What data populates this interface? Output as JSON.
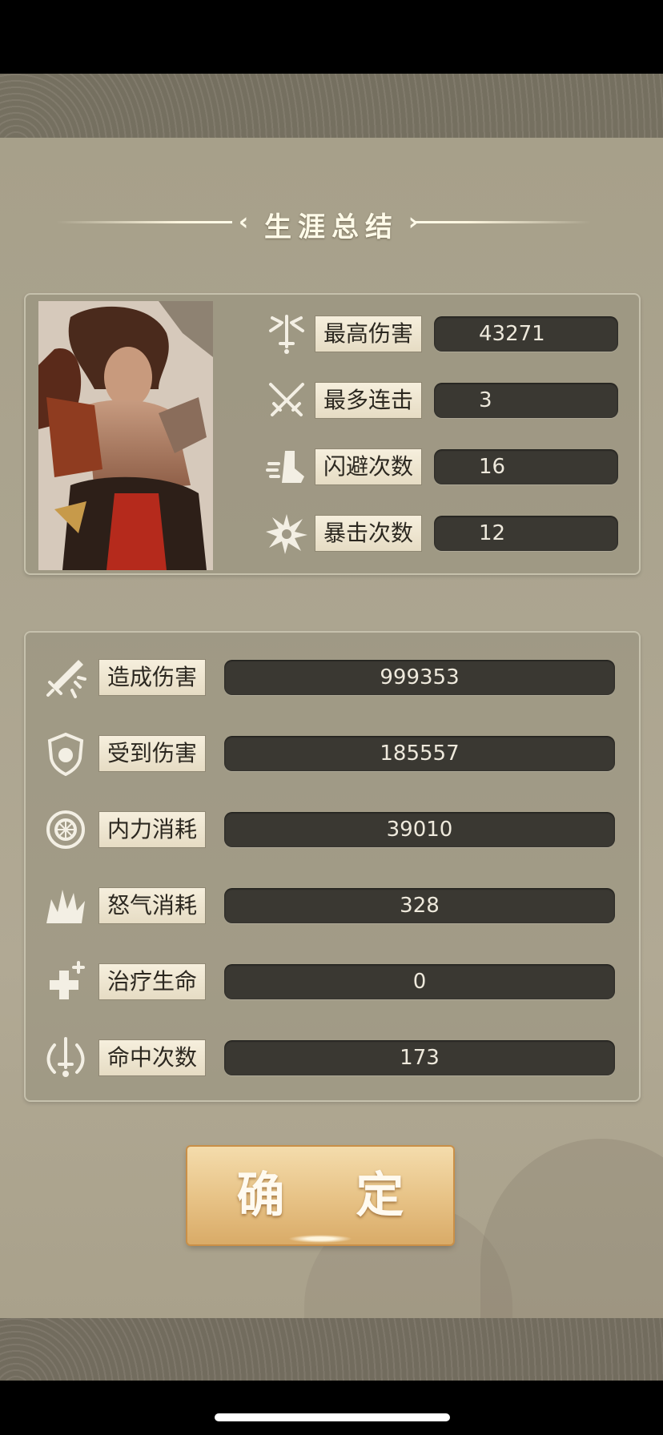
{
  "title": "生涯总结",
  "hero_stats": [
    {
      "icon": "sword-burst-icon",
      "label": "最高伤害",
      "value": "43271"
    },
    {
      "icon": "crossed-swords-icon",
      "label": "最多连击",
      "value": "3"
    },
    {
      "icon": "dodge-boot-icon",
      "label": "闪避次数",
      "value": "16"
    },
    {
      "icon": "critical-burst-icon",
      "label": "暴击次数",
      "value": "12"
    }
  ],
  "totals": [
    {
      "icon": "sword-slash-icon",
      "label": "造成伤害",
      "value": "999353"
    },
    {
      "icon": "shield-icon",
      "label": "受到伤害",
      "value": "185557"
    },
    {
      "icon": "energy-ring-icon",
      "label": "内力消耗",
      "value": "39010"
    },
    {
      "icon": "rage-burst-icon",
      "label": "怒气消耗",
      "value": "328"
    },
    {
      "icon": "heal-plus-icon",
      "label": "治疗生命",
      "value": "0"
    },
    {
      "icon": "hit-target-icon",
      "label": "命中次数",
      "value": "173"
    }
  ],
  "confirm_button": "确 定",
  "colors": {
    "panel": "#aba48f",
    "value_bg": "#3a3832",
    "label_bg": "#efe6d0",
    "button": "#e8c488"
  }
}
